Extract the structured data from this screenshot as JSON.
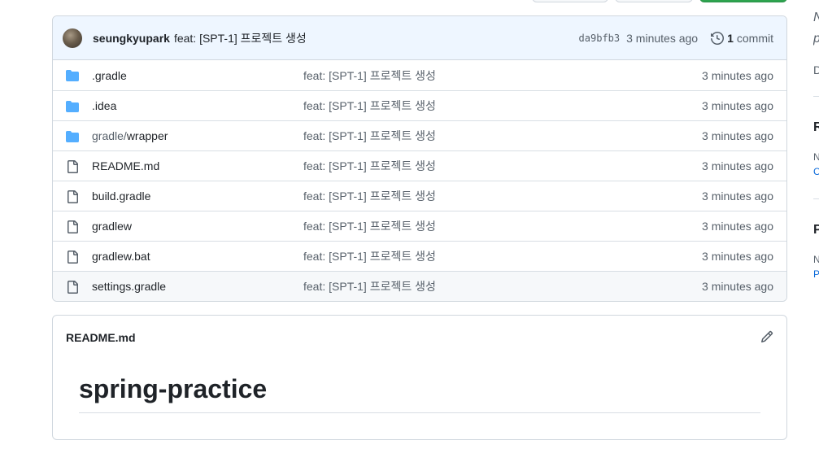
{
  "commit": {
    "author": "seungkyupark",
    "message": "feat: [SPT-1] 프로젝트 생성",
    "sha": "da9bfb3",
    "time": "3 minutes ago",
    "count": "1",
    "count_label": "commit"
  },
  "files": [
    {
      "type": "dir",
      "name": ".gradle",
      "prefix": "",
      "message": "feat: [SPT-1] 프로젝트 생성",
      "time": "3 minutes ago"
    },
    {
      "type": "dir",
      "name": ".idea",
      "prefix": "",
      "message": "feat: [SPT-1] 프로젝트 생성",
      "time": "3 minutes ago"
    },
    {
      "type": "dir",
      "name": "wrapper",
      "prefix": "gradle/",
      "message": "feat: [SPT-1] 프로젝트 생성",
      "time": "3 minutes ago"
    },
    {
      "type": "file",
      "name": "README.md",
      "prefix": "",
      "message": "feat: [SPT-1] 프로젝트 생성",
      "time": "3 minutes ago"
    },
    {
      "type": "file",
      "name": "build.gradle",
      "prefix": "",
      "message": "feat: [SPT-1] 프로젝트 생성",
      "time": "3 minutes ago"
    },
    {
      "type": "file",
      "name": "gradlew",
      "prefix": "",
      "message": "feat: [SPT-1] 프로젝트 생성",
      "time": "3 minutes ago"
    },
    {
      "type": "file",
      "name": "gradlew.bat",
      "prefix": "",
      "message": "feat: [SPT-1] 프로젝트 생성",
      "time": "3 minutes ago"
    },
    {
      "type": "file",
      "name": "settings.gradle",
      "prefix": "",
      "message": "feat: [SPT-1] 프로젝트 생성",
      "time": "3 minutes ago"
    }
  ],
  "readme": {
    "filename": "README.md",
    "heading": "spring-practice"
  },
  "sidebar_fragments": {
    "line1": "N",
    "line2": "p",
    "line3": "D",
    "heading1": "R",
    "sub1a": "N",
    "sub1b": "C",
    "heading2": "P",
    "sub2a": "N",
    "sub2b": "P"
  },
  "icons": {
    "folder": "folder-icon",
    "file": "file-icon",
    "history": "history-icon",
    "edit": "pencil-icon"
  },
  "colors": {
    "folder": "#54aeff",
    "header_bg": "#eef6ff",
    "primary_button": "#2da44e",
    "link": "#0969da"
  }
}
